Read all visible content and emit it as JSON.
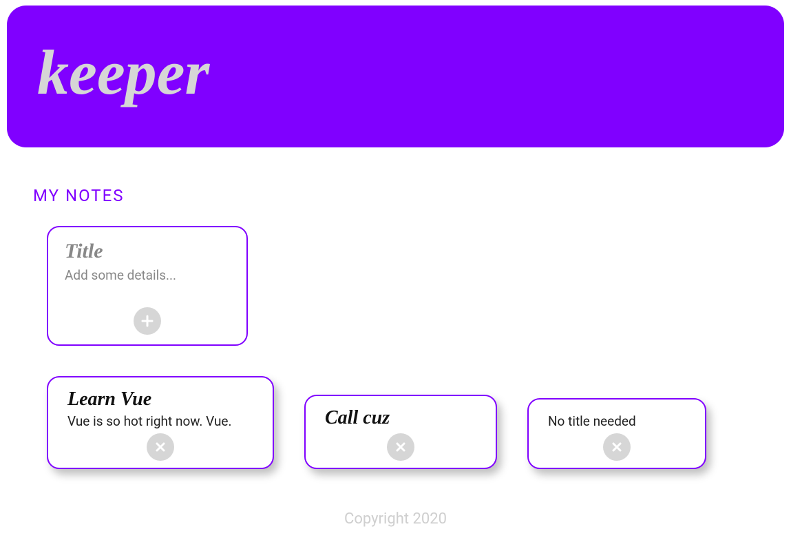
{
  "header": {
    "logo": "keeper"
  },
  "section": {
    "title": "MY NOTES"
  },
  "composer": {
    "title_placeholder": "Title",
    "body_placeholder": "Add some details...",
    "title_value": "",
    "body_value": ""
  },
  "notes": [
    {
      "title": "Learn Vue",
      "body": "Vue is so hot right now. Vue."
    },
    {
      "title": "Call cuz",
      "body": ""
    },
    {
      "title": "",
      "body": "No title needed"
    }
  ],
  "footer": {
    "text": "Copyright 2020"
  },
  "colors": {
    "accent": "#8000ff",
    "muted": "#d6d6d6"
  }
}
